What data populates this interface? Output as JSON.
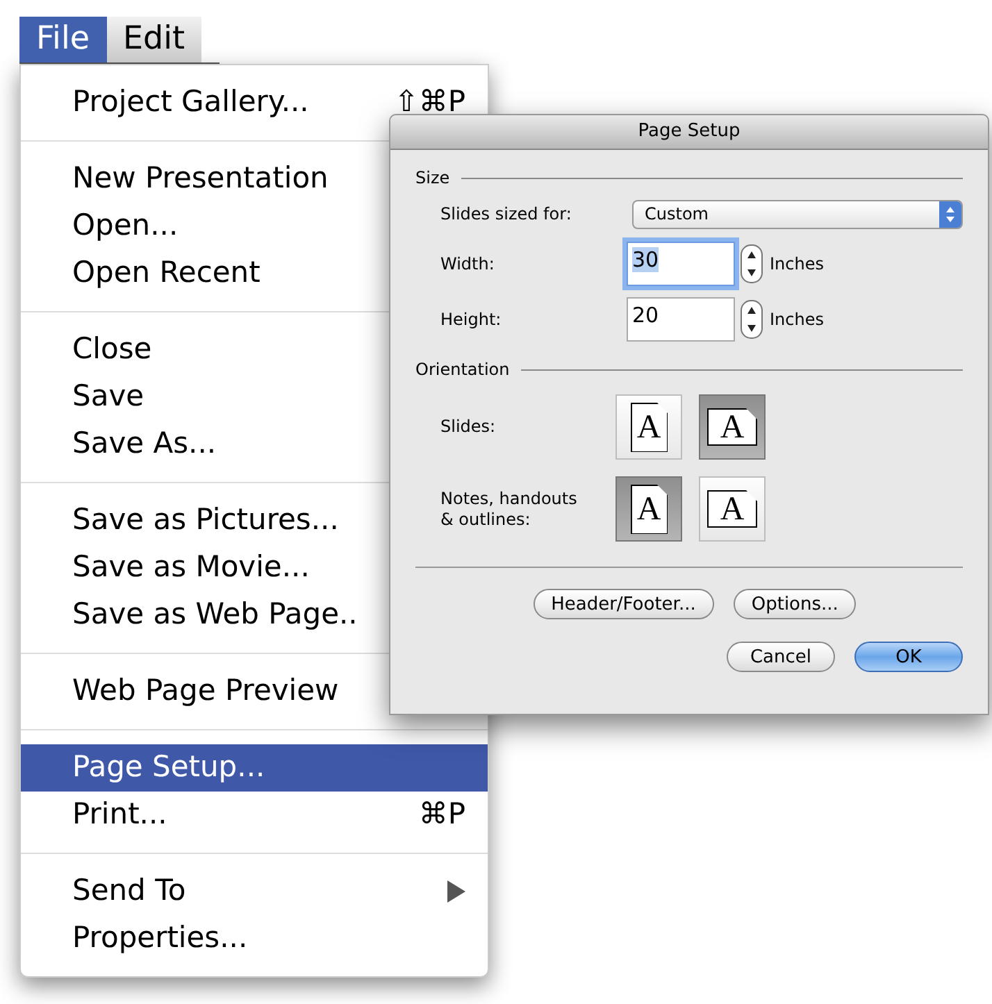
{
  "menubar": [
    {
      "label": "File",
      "selected": true
    },
    {
      "label": "Edit",
      "selected": false
    }
  ],
  "menu": {
    "groups": [
      [
        {
          "label": "Project Gallery...",
          "shortcut": "⇧⌘P",
          "selected": false,
          "submenu": false
        }
      ],
      [
        {
          "label": "New Presentation",
          "selected": false,
          "submenu": false
        },
        {
          "label": "Open...",
          "selected": false,
          "submenu": false
        },
        {
          "label": "Open Recent",
          "selected": false,
          "submenu": false
        }
      ],
      [
        {
          "label": "Close",
          "selected": false,
          "submenu": false
        },
        {
          "label": "Save",
          "selected": false,
          "submenu": false
        },
        {
          "label": "Save As...",
          "selected": false,
          "submenu": false
        }
      ],
      [
        {
          "label": "Save as Pictures...",
          "selected": false,
          "submenu": false
        },
        {
          "label": "Save as Movie...",
          "selected": false,
          "submenu": false
        },
        {
          "label": "Save as Web Page..",
          "selected": false,
          "submenu": false
        }
      ],
      [
        {
          "label": "Web Page Preview",
          "selected": false,
          "submenu": false
        }
      ],
      [
        {
          "label": "Page Setup...",
          "selected": true,
          "submenu": false
        },
        {
          "label": "Print...",
          "shortcut": "⌘P",
          "selected": false,
          "submenu": false
        }
      ],
      [
        {
          "label": "Send To",
          "selected": false,
          "submenu": true
        },
        {
          "label": "Properties...",
          "selected": false,
          "submenu": false
        }
      ]
    ]
  },
  "dialog": {
    "title": "Page Setup",
    "size_section": {
      "heading": "Size",
      "slides_sized_for": {
        "label": "Slides sized for:",
        "value": "Custom"
      },
      "fields": [
        {
          "label": "Width:",
          "value": "30",
          "unit": "Inches",
          "focused": true
        },
        {
          "label": "Height:",
          "value": "20",
          "unit": "Inches",
          "focused": false
        }
      ]
    },
    "orientation_section": {
      "heading": "Orientation",
      "rows": [
        {
          "label": "Slides:",
          "options": [
            {
              "kind": "portrait",
              "letter": "A",
              "selected": false
            },
            {
              "kind": "landscape",
              "letter": "A",
              "selected": true
            }
          ]
        },
        {
          "label": "Notes, handouts\n& outlines:",
          "options": [
            {
              "kind": "portrait",
              "letter": "A",
              "selected": true
            },
            {
              "kind": "landscape",
              "letter": "A",
              "selected": false
            }
          ]
        }
      ]
    },
    "buttons": [
      {
        "label": "Header/Footer...",
        "default": false
      },
      {
        "label": "Options...",
        "default": false
      }
    ],
    "footer_buttons": [
      {
        "label": "Cancel",
        "default": false
      },
      {
        "label": "OK",
        "default": true
      }
    ]
  }
}
